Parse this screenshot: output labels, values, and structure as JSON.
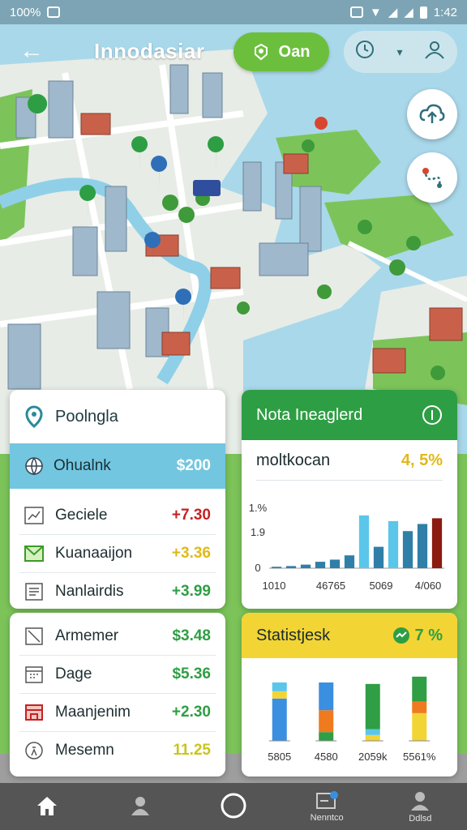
{
  "status_bar": {
    "left_text": "100%",
    "right_text": "1:42"
  },
  "header": {
    "title": "Innodasiar",
    "open_button_label": "Oan"
  },
  "card_top_left": {
    "title": "Poolngla",
    "highlight": {
      "label": "Ohualnk",
      "value": "$200"
    },
    "rows": [
      {
        "label": "Geciele",
        "value": "+7.30",
        "color": "#c42323"
      },
      {
        "label": "Kuanaaijon",
        "value": "+3.36",
        "color": "#e0b91a"
      },
      {
        "label": "Nanlairdis",
        "value": "+3.99",
        "color": "#2f9e44"
      }
    ]
  },
  "card_bottom_left": {
    "rows": [
      {
        "label": "Armemer",
        "value": "$3.48",
        "color": "#2f9e44"
      },
      {
        "label": "Dage",
        "value": "$5.36",
        "color": "#2f9e44"
      },
      {
        "label": "Maanjenim",
        "value": "+2.30",
        "color": "#2f9e44"
      },
      {
        "label": "Mesemn",
        "value": "11.25",
        "color": "#c8c51c"
      }
    ]
  },
  "card_chart_top": {
    "title": "Nota Ineaglerd",
    "subtitle": "moltkocan",
    "badge": "4, 5%",
    "header_color": "#2e9e44"
  },
  "card_chart_bottom": {
    "title": "Statistjesk",
    "badge": "7 %",
    "header_color": "#f2d535"
  },
  "chart_data": [
    {
      "type": "bar",
      "y_ticks": [
        "1.%",
        "1.9",
        "0"
      ],
      "x_ticks": [
        "1010",
        "46765",
        "5069",
        "4/060"
      ],
      "ylim": [
        0,
        1
      ],
      "values": [
        0.02,
        0.03,
        0.05,
        0.09,
        0.12,
        0.18,
        0.74,
        0.3,
        0.66,
        0.52,
        0.62,
        0.7
      ],
      "colors": [
        "#2f7fa8",
        "#2f7fa8",
        "#2f7fa8",
        "#2f7fa8",
        "#2f7fa8",
        "#2f7fa8",
        "#5bc6ea",
        "#2f7fa8",
        "#5bc6ea",
        "#2f7fa8",
        "#2f7fa8",
        "#8b1a10"
      ]
    },
    {
      "type": "bar",
      "x_ticks": [
        "5805",
        "4580",
        "2059k",
        "5561%"
      ],
      "stacks": [
        [
          {
            "value": 0.58,
            "color": "#3b8fe0"
          },
          {
            "value": 0.1,
            "color": "#f2d535"
          },
          {
            "value": 0.12,
            "color": "#5bc6ea"
          }
        ],
        [
          {
            "value": 0.12,
            "color": "#2f9e44"
          },
          {
            "value": 0.3,
            "color": "#f07a1e"
          },
          {
            "value": 0.38,
            "color": "#3b8fe0"
          }
        ],
        [
          {
            "value": 0.08,
            "color": "#f2d535"
          },
          {
            "value": 0.08,
            "color": "#5bc6ea"
          },
          {
            "value": 0.62,
            "color": "#2f9e44"
          }
        ],
        [
          {
            "value": 0.38,
            "color": "#f2d535"
          },
          {
            "value": 0.16,
            "color": "#f07a1e"
          },
          {
            "value": 0.34,
            "color": "#2f9e44"
          }
        ]
      ]
    }
  ],
  "bottom_nav": [
    {
      "icon": "home-icon",
      "label": ""
    },
    {
      "icon": "person-icon",
      "label": ""
    },
    {
      "icon": "circle-icon",
      "label": ""
    },
    {
      "icon": "message-icon",
      "label": "Nenntco"
    },
    {
      "icon": "profile-icon",
      "label": "Ddlsd"
    }
  ]
}
